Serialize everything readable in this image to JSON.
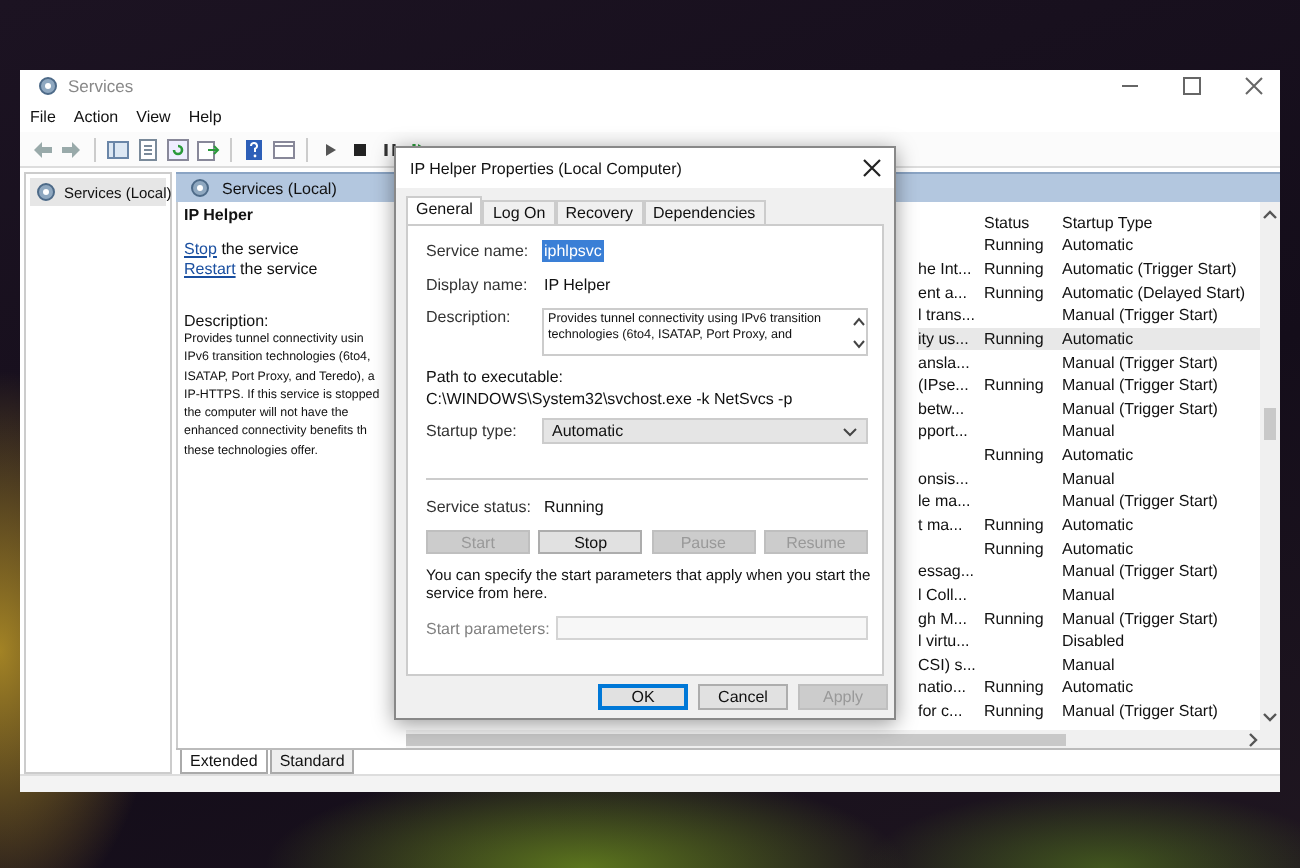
{
  "window": {
    "title": "Services",
    "menu": [
      "File",
      "Action",
      "View",
      "Help"
    ]
  },
  "tree": [
    {
      "label": "Services (Local)",
      "selected": true
    }
  ],
  "pane": {
    "title": "Services (Local)"
  },
  "details": {
    "name": "IP Helper",
    "actions": [
      {
        "link": "Stop",
        "text": " the service"
      },
      {
        "link": "Restart",
        "text": " the service"
      }
    ],
    "description_label": "Description:",
    "description_lines": [
      "Provides tunnel connectivity usin",
      "IPv6 transition technologies (6to4,",
      "ISATAP, Port Proxy, and Teredo), a",
      "IP-HTTPS. If this service is stopped",
      "the computer will not have the",
      "enhanced connectivity benefits th",
      "these technologies offer."
    ]
  },
  "list": {
    "columns": [
      "Status",
      "Startup Type"
    ],
    "rows": [
      {
        "status": "Running",
        "startup_type": "Automatic",
        "selected": false
      },
      {
        "column_1": "he Int...",
        "status": "Running",
        "startup_type": "Automatic (Trigger Start)",
        "selected": false
      },
      {
        "column_1": "ent a...",
        "status": "Running",
        "startup_type": "Automatic (Delayed Start)",
        "selected": false
      },
      {
        "column_1": "l trans...",
        "startup_type": "Manual (Trigger Start)",
        "selected": false
      },
      {
        "column_1": "ity us...",
        "status": "Running",
        "startup_type": "Automatic",
        "selected": true
      },
      {
        "column_1": "ansla...",
        "startup_type": "Manual (Trigger Start)",
        "selected": false
      },
      {
        "column_1": "(IPse...",
        "status": "Running",
        "startup_type": "Manual (Trigger Start)",
        "selected": false
      },
      {
        "column_1": "betw...",
        "startup_type": "Manual (Trigger Start)",
        "selected": false
      },
      {
        "column_1": "pport...",
        "startup_type": "Manual",
        "selected": false
      },
      {
        "status": "Running",
        "startup_type": "Automatic",
        "selected": false
      },
      {
        "column_1": "onsis...",
        "startup_type": "Manual",
        "selected": false
      },
      {
        "column_1": "le ma...",
        "startup_type": "Manual (Trigger Start)",
        "selected": false
      },
      {
        "column_1": "t ma...",
        "status": "Running",
        "startup_type": "Automatic",
        "selected": false
      },
      {
        "status": "Running",
        "startup_type": "Automatic",
        "selected": false
      },
      {
        "column_1": "essag...",
        "startup_type": "Manual (Trigger Start)",
        "selected": false
      },
      {
        "column_1": "l Coll...",
        "startup_type": "Manual",
        "selected": false
      },
      {
        "column_1": "gh M...",
        "status": "Running",
        "startup_type": "Manual (Trigger Start)",
        "selected": false
      },
      {
        "column_1": "l virtu...",
        "startup_type": "Disabled",
        "selected": false
      },
      {
        "column_1": "CSI) s...",
        "startup_type": "Manual",
        "selected": false
      },
      {
        "column_1": "natio...",
        "status": "Running",
        "startup_type": "Automatic",
        "selected": false
      },
      {
        "column_1": "for c...",
        "status": "Running",
        "startup_type": "Manual (Trigger Start)",
        "selected": false
      }
    ]
  },
  "view_tabs": [
    {
      "label": "Extended",
      "selected": true
    },
    {
      "label": "Standard",
      "selected": false
    }
  ],
  "dialog": {
    "title": "IP Helper Properties (Local Computer)",
    "tabs": [
      {
        "label": "General",
        "selected": true
      },
      {
        "label": "Log On",
        "selected": false
      },
      {
        "label": "Recovery",
        "selected": false
      },
      {
        "label": "Dependencies",
        "selected": false
      }
    ],
    "service_name": {
      "label": "Service name:",
      "value": "iphlpsvc",
      "value_selected": true
    },
    "display_name": {
      "label": "Display name:",
      "value": "IP Helper"
    },
    "description": {
      "label": "Description:",
      "lines": [
        "Provides tunnel connectivity using IPv6 transition",
        "technologies (6to4, ISATAP, Port Proxy, and"
      ]
    },
    "path": {
      "label": "Path to executable:",
      "value": "C:\\WINDOWS\\System32\\svchost.exe -k NetSvcs -p"
    },
    "startup_type": {
      "label": "Startup type:",
      "value": "Automatic"
    },
    "service_status": {
      "label": "Service status:",
      "value": "Running"
    },
    "control_buttons": [
      {
        "label": "Start",
        "disabled": true
      },
      {
        "label": "Stop",
        "disabled": false
      },
      {
        "label": "Pause",
        "disabled": true
      },
      {
        "label": "Resume",
        "disabled": true
      }
    ],
    "hint": "You can specify the start parameters that apply when you start the service from here.",
    "start_parameters": {
      "label": "Start parameters:",
      "disabled": true
    },
    "buttons": [
      {
        "label": "OK",
        "default": true,
        "disabled": false
      },
      {
        "label": "Cancel",
        "default": false,
        "disabled": false
      },
      {
        "label": "Apply",
        "default": false,
        "disabled": true
      }
    ]
  }
}
